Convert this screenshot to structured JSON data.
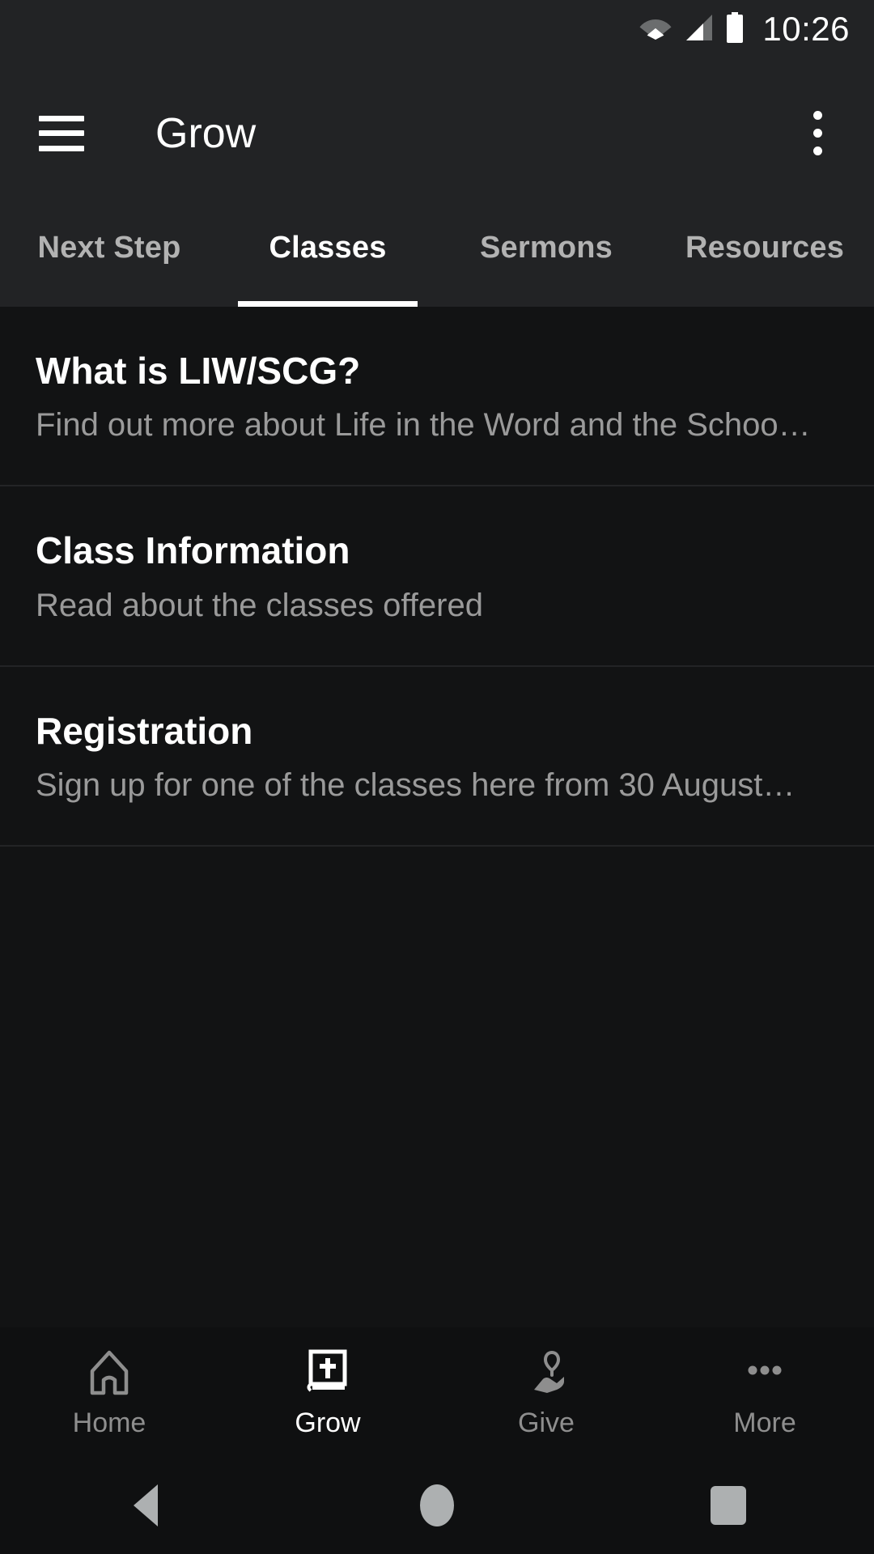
{
  "status_bar": {
    "time": "10:26",
    "icons": [
      "wifi-icon",
      "cellular-signal-icon",
      "battery-icon"
    ],
    "background": "#222325"
  },
  "app_bar": {
    "menu_icon": "hamburger-menu-icon",
    "title": "Grow",
    "overflow_icon": "overflow-menu-icon"
  },
  "tabs": {
    "active_index": 1,
    "items": [
      {
        "label": "Next Step"
      },
      {
        "label": "Classes"
      },
      {
        "label": "Sermons"
      },
      {
        "label": "Resources"
      }
    ]
  },
  "list": {
    "items": [
      {
        "title": "What is LIW/SCG?",
        "subtitle": "Find out more about Life in the Word and the Schoo…"
      },
      {
        "title": "Class Information",
        "subtitle": "Read about the classes offered"
      },
      {
        "title": "Registration",
        "subtitle": "Sign up for one of the classes here from 30 August…"
      }
    ]
  },
  "bottom_nav": {
    "active_index": 1,
    "items": [
      {
        "label": "Home",
        "icon": "church-home-icon"
      },
      {
        "label": "Grow",
        "icon": "bible-book-icon"
      },
      {
        "label": "Give",
        "icon": "hand-heart-icon"
      },
      {
        "label": "More",
        "icon": "more-dots-icon"
      }
    ]
  },
  "system_nav": {
    "back": "back-triangle-icon",
    "home": "home-circle-icon",
    "recents": "recents-square-icon"
  },
  "colors": {
    "app_bar_bg": "#222325",
    "content_bg": "#121314",
    "nav_bg": "#0f1011",
    "active_text": "#ffffff",
    "inactive_text": "#8e8e8e",
    "subtitle_text": "#9a9a9a",
    "divider": "#232426"
  }
}
